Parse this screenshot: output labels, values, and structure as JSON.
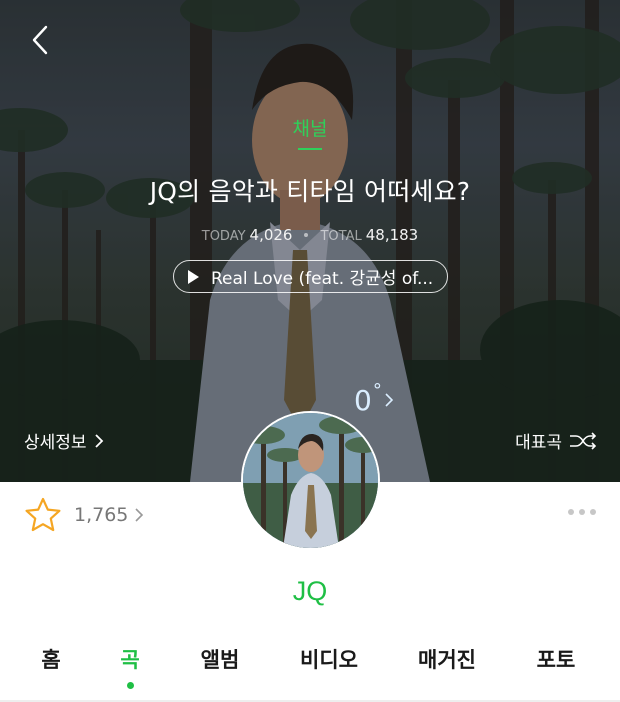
{
  "header": {
    "back_icon": "chevron-left-icon",
    "section_label": "채널",
    "channel_title": "JQ의 음악과 티타임 어떠세요?",
    "accent_color": "#2fd05a"
  },
  "stats": {
    "today_label": "TODAY",
    "today_value": "4,026",
    "total_label": "TOTAL",
    "total_value": "48,183"
  },
  "now_playing": {
    "icon": "play-icon",
    "text": "Real Love (feat. 강균성 of..."
  },
  "weather": {
    "value": "0",
    "unit": "°"
  },
  "links": {
    "detail_label": "상세정보",
    "top_song_label": "대표곡",
    "shuffle_icon": "shuffle-icon"
  },
  "profile": {
    "fan_icon": "star-icon",
    "fan_count": "1,765",
    "artist_name": "JQ",
    "brand_color": "#1fbf45"
  },
  "tabs": {
    "items": [
      {
        "label": "홈"
      },
      {
        "label": "곡"
      },
      {
        "label": "앨범"
      },
      {
        "label": "비디오"
      },
      {
        "label": "매거진"
      },
      {
        "label": "포토"
      }
    ],
    "active_index": 1
  }
}
